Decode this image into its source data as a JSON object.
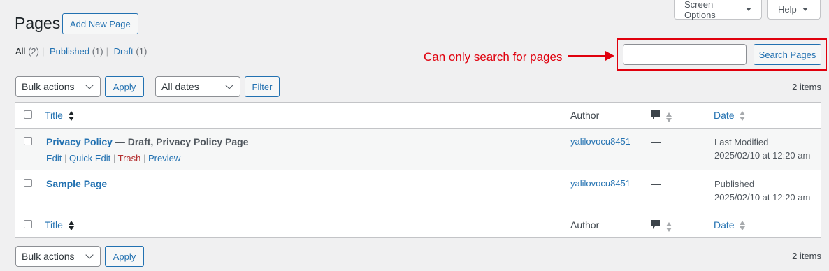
{
  "header": {
    "screen_options": "Screen Options",
    "help": "Help",
    "title": "Pages",
    "add_new": "Add New Page"
  },
  "views": [
    {
      "label": "All",
      "count": "(2)"
    },
    {
      "label": "Published",
      "count": "(1)"
    },
    {
      "label": "Draft",
      "count": "(1)"
    }
  ],
  "annotation": {
    "text": "Can only search for pages",
    "color": "#e0000d"
  },
  "search": {
    "value": "",
    "button": "Search Pages"
  },
  "top_nav": {
    "bulk_actions": "Bulk actions",
    "apply": "Apply",
    "dates": "All dates",
    "filter": "Filter",
    "items": "2 items"
  },
  "table": {
    "headers": {
      "title": "Title",
      "author": "Author",
      "comments_icon": "comment-bubble-icon",
      "date": "Date"
    },
    "rows": [
      {
        "title": "Privacy Policy",
        "state": " — Draft, Privacy Policy Page",
        "actions": [
          "Edit",
          "Quick Edit",
          "Trash",
          "Preview"
        ],
        "author": "yalilovocu8451",
        "comments": "—",
        "date_status": "Last Modified",
        "date": "2025/02/10 at 12:20 am"
      },
      {
        "title": "Sample Page",
        "state": "",
        "actions": [],
        "author": "yalilovocu8451",
        "comments": "—",
        "date_status": "Published",
        "date": "2025/02/10 at 12:20 am"
      }
    ]
  },
  "bottom_nav": {
    "bulk_actions": "Bulk actions",
    "apply": "Apply",
    "items": "2 items"
  },
  "colors": {
    "link": "#2271b1",
    "trash": "#b32d2e",
    "background": "#f0f0f1"
  }
}
